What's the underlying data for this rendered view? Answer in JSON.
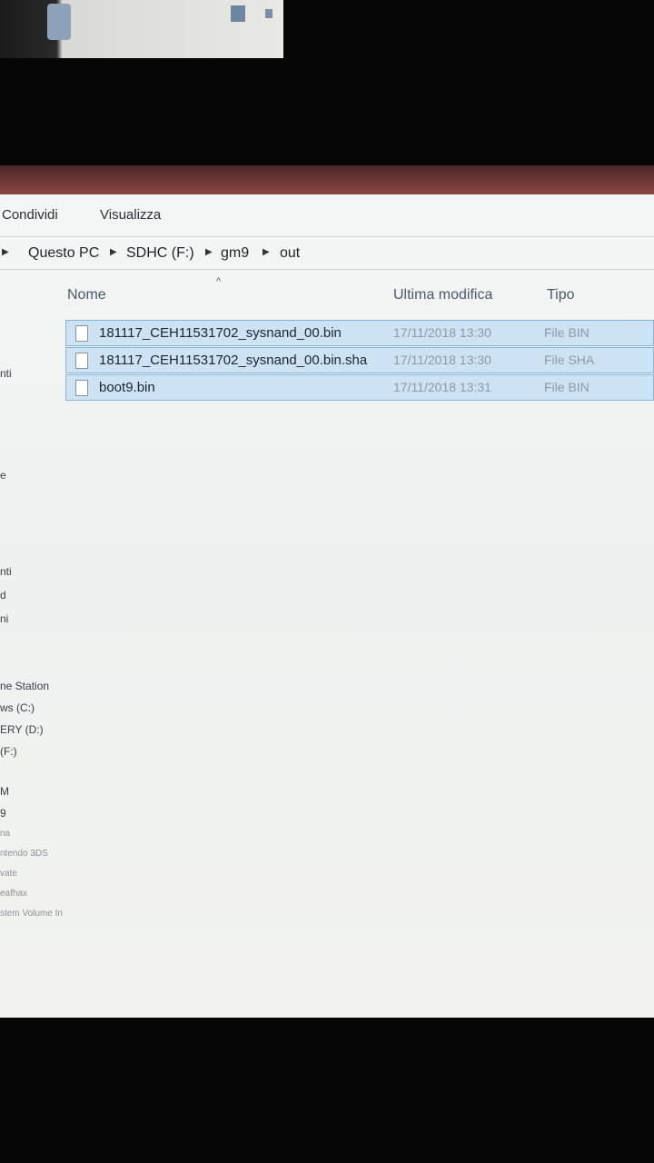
{
  "ribbon": {
    "tab_share": "Condividi",
    "tab_view": "Visualizza"
  },
  "breadcrumb": {
    "items": [
      "Questo PC",
      "SDHC (F:)",
      "gm9",
      "out"
    ]
  },
  "columns": {
    "name": "Nome",
    "modified": "Ultima modifica",
    "type": "Tipo"
  },
  "files": [
    {
      "name": "181117_CEH11531702_sysnand_00.bin",
      "modified": "17/11/2018 13:30",
      "type": "File BIN"
    },
    {
      "name": "181117_CEH11531702_sysnand_00.bin.sha",
      "modified": "17/11/2018 13:30",
      "type": "File SHA"
    },
    {
      "name": "boot9.bin",
      "modified": "17/11/2018 13:31",
      "type": "File BIN"
    }
  ],
  "nav_pane": {
    "items": [
      "nti",
      "e",
      "nti",
      "d",
      "ni",
      "ne Station",
      "ws (C:)",
      "ERY (D:)",
      "(F:)",
      "M",
      "9",
      "na",
      "ntendo 3DS",
      "vate",
      "eafhax",
      "stem Volume In"
    ]
  },
  "colors": {
    "selection_bg": "#cde3f3",
    "selection_border": "#86b5d8",
    "window_bg": "#f4f6f6"
  }
}
